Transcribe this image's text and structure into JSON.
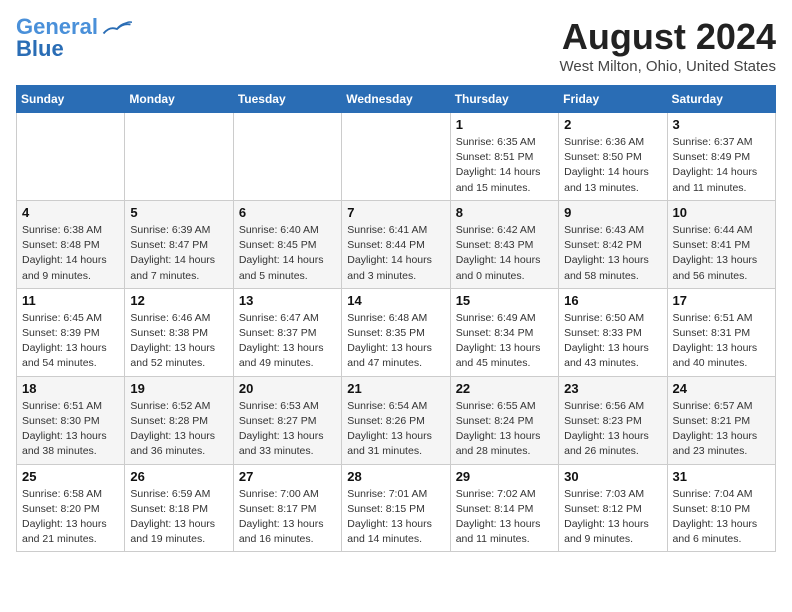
{
  "logo": {
    "line1": "General",
    "line2": "Blue"
  },
  "title": "August 2024",
  "location": "West Milton, Ohio, United States",
  "days_header": [
    "Sunday",
    "Monday",
    "Tuesday",
    "Wednesday",
    "Thursday",
    "Friday",
    "Saturday"
  ],
  "weeks": [
    [
      {
        "day": "",
        "info": ""
      },
      {
        "day": "",
        "info": ""
      },
      {
        "day": "",
        "info": ""
      },
      {
        "day": "",
        "info": ""
      },
      {
        "day": "1",
        "info": "Sunrise: 6:35 AM\nSunset: 8:51 PM\nDaylight: 14 hours\nand 15 minutes."
      },
      {
        "day": "2",
        "info": "Sunrise: 6:36 AM\nSunset: 8:50 PM\nDaylight: 14 hours\nand 13 minutes."
      },
      {
        "day": "3",
        "info": "Sunrise: 6:37 AM\nSunset: 8:49 PM\nDaylight: 14 hours\nand 11 minutes."
      }
    ],
    [
      {
        "day": "4",
        "info": "Sunrise: 6:38 AM\nSunset: 8:48 PM\nDaylight: 14 hours\nand 9 minutes."
      },
      {
        "day": "5",
        "info": "Sunrise: 6:39 AM\nSunset: 8:47 PM\nDaylight: 14 hours\nand 7 minutes."
      },
      {
        "day": "6",
        "info": "Sunrise: 6:40 AM\nSunset: 8:45 PM\nDaylight: 14 hours\nand 5 minutes."
      },
      {
        "day": "7",
        "info": "Sunrise: 6:41 AM\nSunset: 8:44 PM\nDaylight: 14 hours\nand 3 minutes."
      },
      {
        "day": "8",
        "info": "Sunrise: 6:42 AM\nSunset: 8:43 PM\nDaylight: 14 hours\nand 0 minutes."
      },
      {
        "day": "9",
        "info": "Sunrise: 6:43 AM\nSunset: 8:42 PM\nDaylight: 13 hours\nand 58 minutes."
      },
      {
        "day": "10",
        "info": "Sunrise: 6:44 AM\nSunset: 8:41 PM\nDaylight: 13 hours\nand 56 minutes."
      }
    ],
    [
      {
        "day": "11",
        "info": "Sunrise: 6:45 AM\nSunset: 8:39 PM\nDaylight: 13 hours\nand 54 minutes."
      },
      {
        "day": "12",
        "info": "Sunrise: 6:46 AM\nSunset: 8:38 PM\nDaylight: 13 hours\nand 52 minutes."
      },
      {
        "day": "13",
        "info": "Sunrise: 6:47 AM\nSunset: 8:37 PM\nDaylight: 13 hours\nand 49 minutes."
      },
      {
        "day": "14",
        "info": "Sunrise: 6:48 AM\nSunset: 8:35 PM\nDaylight: 13 hours\nand 47 minutes."
      },
      {
        "day": "15",
        "info": "Sunrise: 6:49 AM\nSunset: 8:34 PM\nDaylight: 13 hours\nand 45 minutes."
      },
      {
        "day": "16",
        "info": "Sunrise: 6:50 AM\nSunset: 8:33 PM\nDaylight: 13 hours\nand 43 minutes."
      },
      {
        "day": "17",
        "info": "Sunrise: 6:51 AM\nSunset: 8:31 PM\nDaylight: 13 hours\nand 40 minutes."
      }
    ],
    [
      {
        "day": "18",
        "info": "Sunrise: 6:51 AM\nSunset: 8:30 PM\nDaylight: 13 hours\nand 38 minutes."
      },
      {
        "day": "19",
        "info": "Sunrise: 6:52 AM\nSunset: 8:28 PM\nDaylight: 13 hours\nand 36 minutes."
      },
      {
        "day": "20",
        "info": "Sunrise: 6:53 AM\nSunset: 8:27 PM\nDaylight: 13 hours\nand 33 minutes."
      },
      {
        "day": "21",
        "info": "Sunrise: 6:54 AM\nSunset: 8:26 PM\nDaylight: 13 hours\nand 31 minutes."
      },
      {
        "day": "22",
        "info": "Sunrise: 6:55 AM\nSunset: 8:24 PM\nDaylight: 13 hours\nand 28 minutes."
      },
      {
        "day": "23",
        "info": "Sunrise: 6:56 AM\nSunset: 8:23 PM\nDaylight: 13 hours\nand 26 minutes."
      },
      {
        "day": "24",
        "info": "Sunrise: 6:57 AM\nSunset: 8:21 PM\nDaylight: 13 hours\nand 23 minutes."
      }
    ],
    [
      {
        "day": "25",
        "info": "Sunrise: 6:58 AM\nSunset: 8:20 PM\nDaylight: 13 hours\nand 21 minutes."
      },
      {
        "day": "26",
        "info": "Sunrise: 6:59 AM\nSunset: 8:18 PM\nDaylight: 13 hours\nand 19 minutes."
      },
      {
        "day": "27",
        "info": "Sunrise: 7:00 AM\nSunset: 8:17 PM\nDaylight: 13 hours\nand 16 minutes."
      },
      {
        "day": "28",
        "info": "Sunrise: 7:01 AM\nSunset: 8:15 PM\nDaylight: 13 hours\nand 14 minutes."
      },
      {
        "day": "29",
        "info": "Sunrise: 7:02 AM\nSunset: 8:14 PM\nDaylight: 13 hours\nand 11 minutes."
      },
      {
        "day": "30",
        "info": "Sunrise: 7:03 AM\nSunset: 8:12 PM\nDaylight: 13 hours\nand 9 minutes."
      },
      {
        "day": "31",
        "info": "Sunrise: 7:04 AM\nSunset: 8:10 PM\nDaylight: 13 hours\nand 6 minutes."
      }
    ]
  ]
}
